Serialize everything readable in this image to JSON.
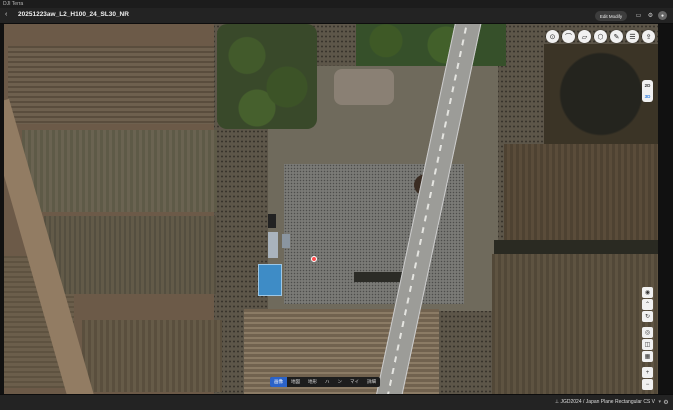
{
  "window": {
    "app_name": "DJI Terra"
  },
  "header": {
    "back_glyph": "‹",
    "project_title": "20251223aw_L2_H100_24_SL30_NR",
    "edit_glyph": "✎",
    "edit_mode_label": "Edit Modify",
    "right_icons": [
      "monitor-icon",
      "settings-icon"
    ]
  },
  "top_tools": [
    {
      "name": "measure-point-icon",
      "glyph": "⊙"
    },
    {
      "name": "measure-line-icon",
      "glyph": "⌒"
    },
    {
      "name": "measure-area-icon",
      "glyph": "▱"
    },
    {
      "name": "measure-volume-icon",
      "glyph": "⬡"
    },
    {
      "name": "annotation-icon",
      "glyph": "✎"
    },
    {
      "name": "layers-icon",
      "glyph": "☰"
    },
    {
      "name": "export-icon",
      "glyph": "⇪"
    }
  ],
  "dimension_toggle": {
    "options": [
      "2D",
      "3D"
    ],
    "active": "3D"
  },
  "right_tools": [
    {
      "name": "compass-icon",
      "glyph": "◉"
    },
    {
      "name": "tilt-icon",
      "glyph": "⌃"
    },
    {
      "name": "rotate-icon",
      "glyph": "↻"
    },
    {
      "name": "locate-icon",
      "glyph": "◎"
    },
    {
      "name": "layer-icon",
      "glyph": "◫"
    },
    {
      "name": "grid-icon",
      "glyph": "▦"
    },
    {
      "name": "zoom-in-icon",
      "glyph": "+"
    },
    {
      "name": "zoom-out-icon",
      "glyph": "−"
    }
  ],
  "basemap_bar": {
    "items": [
      "画像",
      "地図",
      "地形",
      "ハ",
      "ン",
      "マイ",
      "詳細"
    ],
    "active_index": 0
  },
  "status": {
    "crs_label": "⊥ JGD2024 / Japan Plane Rectangular CS V",
    "chevron": "▾"
  }
}
